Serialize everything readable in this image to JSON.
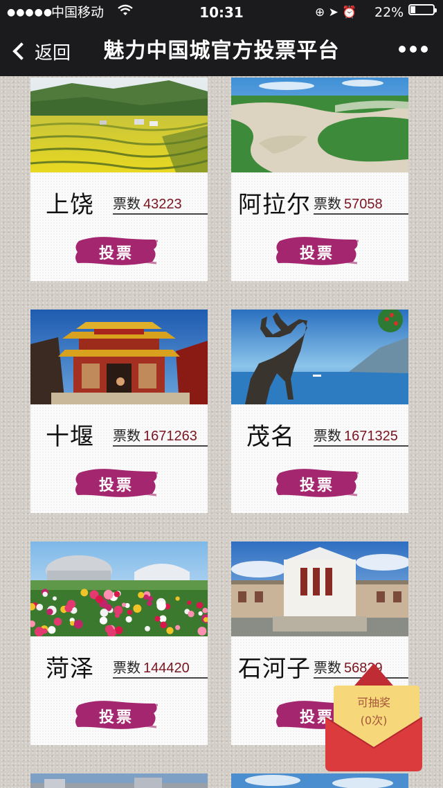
{
  "status_bar": {
    "signal": "●●●●●",
    "carrier": "中国移动",
    "time": "10:31",
    "icons": "⊕ ➤ ⏰",
    "battery_percent_text": "22%",
    "battery_level": 0.22
  },
  "nav": {
    "back_label": "返回",
    "title": "魅力中国城官方投票平台"
  },
  "cities": [
    {
      "name": "上饶",
      "votes_label": "票数",
      "votes": "43223",
      "vote_button": "投票",
      "photo": "terraced-rapeseed-fields-photo"
    },
    {
      "name": "阿拉尔",
      "votes_label": "票数",
      "votes": "57058",
      "vote_button": "投票",
      "photo": "river-wetland-aerial-photo"
    },
    {
      "name": "十堰",
      "votes_label": "票数",
      "votes": "1671263",
      "vote_button": "投票",
      "photo": "taoist-temple-photo"
    },
    {
      "name": "茂名",
      "votes_label": "票数",
      "votes": "1671325",
      "vote_button": "投票",
      "photo": "equestrian-statue-sea-photo"
    },
    {
      "name": "菏泽",
      "votes_label": "票数",
      "votes": "144420",
      "vote_button": "投票",
      "photo": "peony-garden-stadium-photo"
    },
    {
      "name": "石河子",
      "votes_label": "票数",
      "votes": "56829",
      "vote_button": "投票",
      "photo": "museum-building-photo"
    }
  ],
  "lottery": {
    "line1": "可抽奖",
    "line2": "(0次)"
  },
  "colors": {
    "top_bar": "#1b1b1d",
    "vote_button": "#a3266f",
    "vote_count": "#7a1420",
    "envelope": "#d63a3a"
  }
}
